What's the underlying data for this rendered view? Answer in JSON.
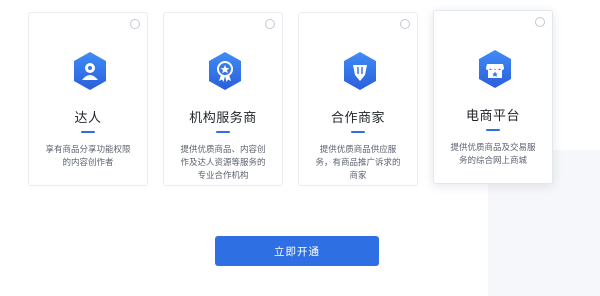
{
  "cards": [
    {
      "title": "达人",
      "description": "享有商品分享功能权限\n的内容创作者",
      "icon": "person-icon",
      "selected": false
    },
    {
      "title": "机构服务商",
      "description": "提供优质商品、内容创\n作及达人资源等服务的\n专业合作机构",
      "icon": "badge-icon",
      "selected": false
    },
    {
      "title": "合作商家",
      "description": "提供优质商品供应服\n务，有商品推广诉求的\n商家",
      "icon": "diamond-pen-icon",
      "selected": false
    },
    {
      "title": "电商平台",
      "description": "提供优质商品及交易服\n务的综合网上商城",
      "icon": "store-icon",
      "selected": true
    }
  ],
  "primary_button": {
    "label": "立即开通"
  },
  "colors": {
    "accent": "#2f6fe4",
    "icon_gradient_top": "#3f8cf5",
    "icon_gradient_bottom": "#2a5fdc"
  }
}
